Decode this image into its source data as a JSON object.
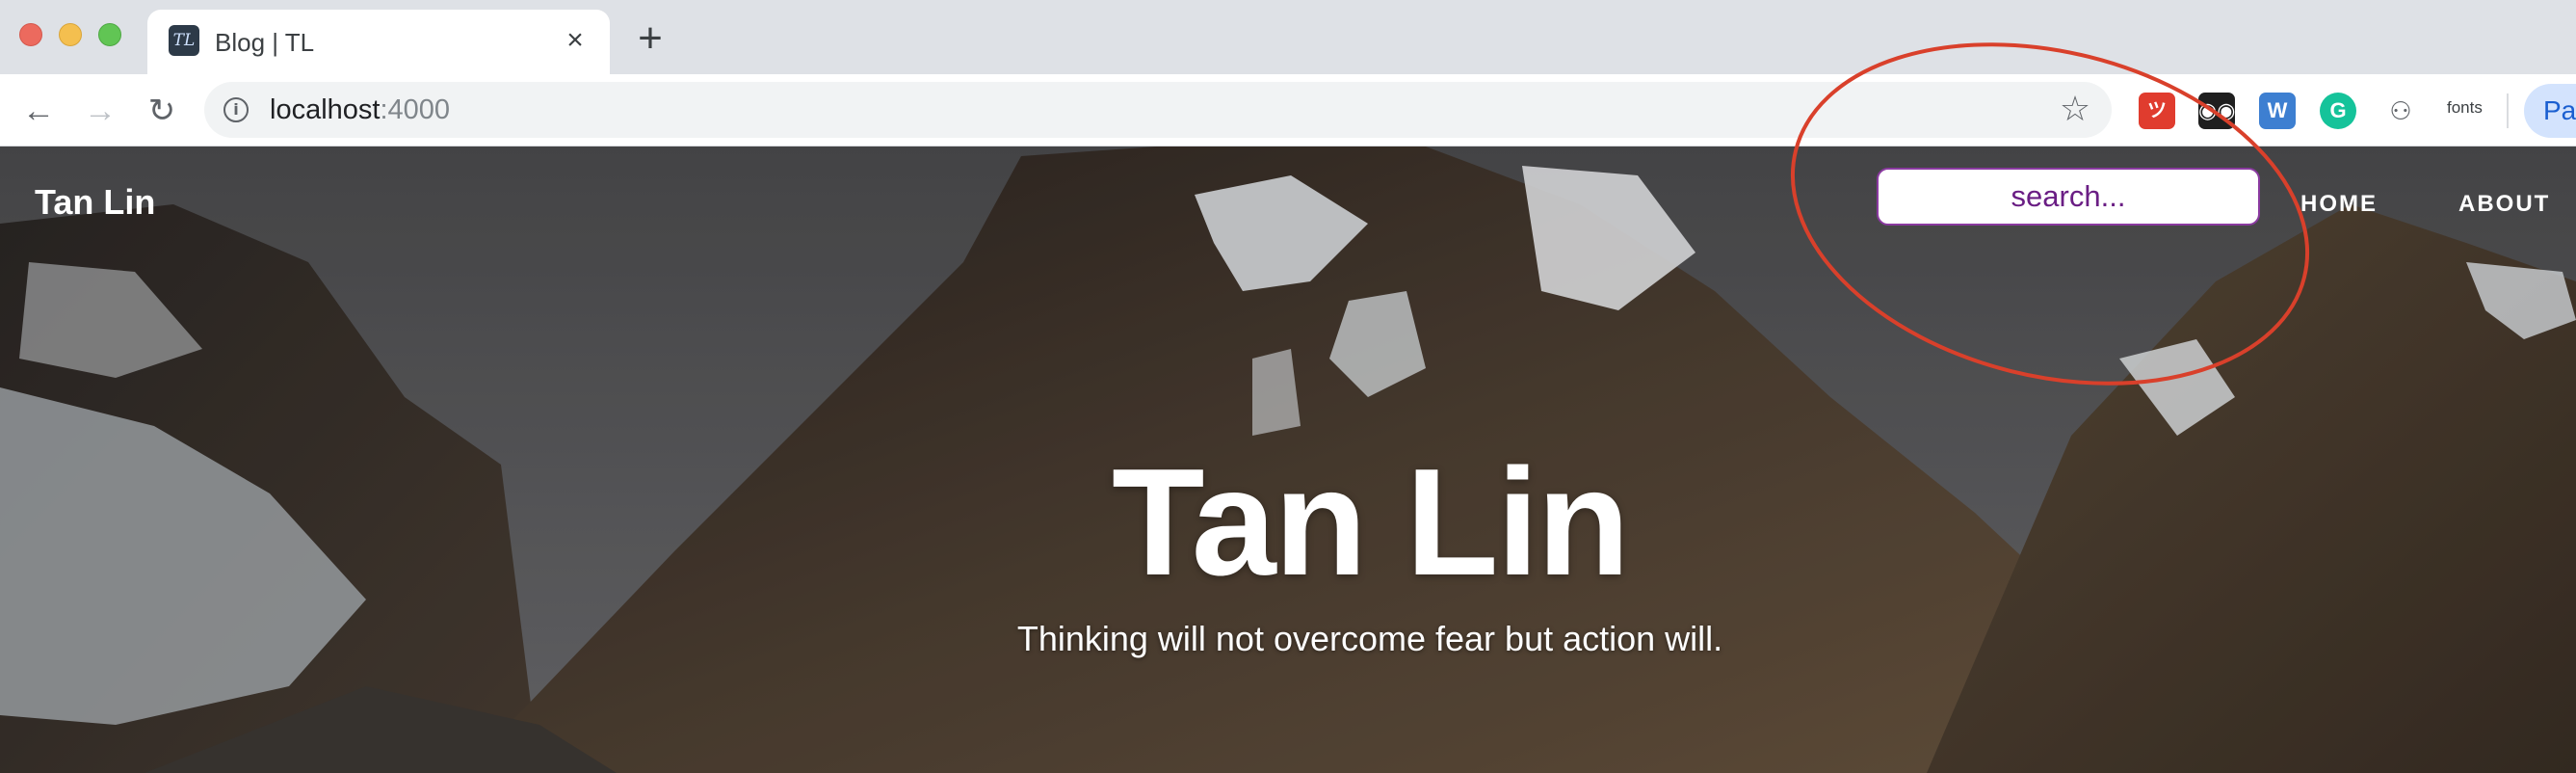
{
  "browser": {
    "tab": {
      "title": "Blog | TL",
      "favicon_text": "TL"
    },
    "address": {
      "host": "localhost",
      "port": ":4000"
    },
    "extensions": [
      {
        "name": "extension-1",
        "glyph": "ツ"
      },
      {
        "name": "extension-2",
        "glyph": "◉◉"
      },
      {
        "name": "extension-3",
        "glyph": "W"
      },
      {
        "name": "extension-4",
        "glyph": "G"
      },
      {
        "name": "extension-5",
        "glyph": "⚇"
      }
    ],
    "fonts_extension_label": "fonts",
    "profile_label": "Pa"
  },
  "page": {
    "site_title": "Tan Lin",
    "search": {
      "placeholder": "search..."
    },
    "nav": {
      "home": "HOME",
      "about": "ABOUT"
    },
    "hero": {
      "title": "Tan Lin",
      "subtitle": "Thinking will not overcome fear but action will."
    }
  },
  "colors": {
    "annotation_ellipse": "#d9402b",
    "search_border": "#8a3aa0",
    "search_text": "#6a1e84"
  }
}
